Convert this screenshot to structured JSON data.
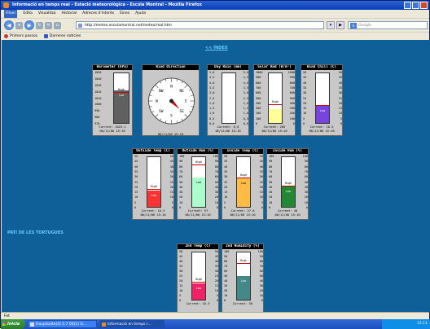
{
  "window": {
    "title": "Informació en temps real - Estació meteorològica - Escola Montral - Mozilla Firefox"
  },
  "menu": [
    "Fitxer",
    "Edita",
    "Visualitza",
    "Historial",
    "Adreces d'interès",
    "Eines",
    "Ajuda"
  ],
  "nav": {
    "url": "http://meteo.escolamontral.net/meteo/real.htm",
    "search_placeholder": "Google",
    "search_engine_icon": "G"
  },
  "bookmarks": [
    "Primers passos",
    "Darreres notícies"
  ],
  "page": {
    "index_link": "<< ÍNDEX",
    "side_link": "PATI DE LES TORTUGUES"
  },
  "compass": {
    "title": "Wind Direction",
    "direction_deg": 135,
    "date": "06/11/06 15:10",
    "points": [
      "N",
      "NE",
      "E",
      "SE",
      "S",
      "SW",
      "W",
      "NW"
    ]
  },
  "gauges": [
    {
      "title": "Barometer (hPa)",
      "ticks": [
        "1050",
        "1040",
        "1030",
        "1020",
        "1010",
        "1000",
        "990",
        "980",
        "970"
      ],
      "fill": 0.64,
      "high": 0.64,
      "low_label": "Low",
      "high_label": "High",
      "color": "#606060",
      "current": "Current: 1025.1",
      "date": "06/11/06 15:10"
    },
    {
      "title": "Day Rain (mm)",
      "ticks": [
        "5,0",
        "4,5",
        "4,0",
        "3,5",
        "3,0",
        "2,5",
        "2,0",
        "1,5",
        "1,0",
        "0,5",
        "0,0"
      ],
      "ticks2": [
        "5,0",
        "4,5",
        "4,0",
        "3,5",
        "3,0",
        "2,5",
        "2,0",
        "1,5",
        "1,0",
        "0,5",
        "0,0"
      ],
      "fill": 0,
      "high": null,
      "color": "#606060",
      "current": "Current: 0,0",
      "date": "06/11/06 15:10"
    },
    {
      "title": "Solar Rad (W/m²)",
      "ticks": [
        "1000",
        "900",
        "800",
        "700",
        "600",
        "500",
        "400",
        "300",
        "200",
        "100",
        "0"
      ],
      "ticks2": [
        "1000",
        "900",
        "800",
        "700",
        "600",
        "500",
        "400",
        "300",
        "200",
        "100",
        "0"
      ],
      "fill": 0.27,
      "high": 0.4,
      "low_label": "",
      "high_label": "High",
      "color": "#ffff99",
      "current": "Current: 285",
      "date": "06/11/06 15:10"
    },
    {
      "title": "Wind Chill (C)",
      "ticks": [
        "50",
        "45",
        "40",
        "35",
        "30",
        "25",
        "20",
        "15",
        "10",
        "5",
        "0"
      ],
      "ticks2": [
        "50",
        "45",
        "40",
        "35",
        "30",
        "25",
        "20",
        "15",
        "10",
        "5",
        "0"
      ],
      "fill": 0.33,
      "high": 0.38,
      "low_label": "Low",
      "high_label": "",
      "color": "#7744dd",
      "current": "Current: 16.5",
      "date": "06/11/06 15:10"
    },
    {
      "title": "Outside Temp (C)",
      "ticks": [
        "50",
        "45",
        "40",
        "35",
        "30",
        "25",
        "20",
        "15",
        "10",
        "5",
        "0"
      ],
      "ticks2": [
        "50",
        "45",
        "40",
        "35",
        "30",
        "25",
        "20",
        "15",
        "10",
        "5",
        "0"
      ],
      "fill": 0.32,
      "high": 0.38,
      "low_label": "Low",
      "high_label": "High",
      "color": "#ff3333",
      "current": "Current: 16.5",
      "date": "06/11/06 15:10"
    },
    {
      "title": "Outside Hum (%)",
      "ticks": [
        "100",
        "90",
        "80",
        "70",
        "60",
        "50",
        "40",
        "30",
        "20",
        "10",
        "0"
      ],
      "ticks2": [
        "100",
        "90",
        "80",
        "70",
        "60",
        "50",
        "40",
        "30",
        "20",
        "10",
        "0"
      ],
      "fill": 0.57,
      "high": 0.86,
      "low_label": "Low",
      "high_label": "High",
      "color": "#aaffcc",
      "current": "Current: 57",
      "date": "06/11/06 15:10"
    },
    {
      "title": "Inside Temp (C)",
      "ticks": [
        "50",
        "45",
        "40",
        "35",
        "30",
        "25",
        "20",
        "15",
        "10",
        "5",
        "0"
      ],
      "ticks2": [
        "50",
        "45",
        "40",
        "35",
        "30",
        "25",
        "20",
        "15",
        "10",
        "5",
        "0"
      ],
      "fill": 0.55,
      "high": 0.6,
      "low_label": "Low",
      "high_label": "High",
      "color": "#ffbb44",
      "current": "Current: 27.6",
      "date": "06/11/06 15:10"
    },
    {
      "title": "Inside Hum (%)",
      "ticks": [
        "100",
        "90",
        "80",
        "70",
        "60",
        "50",
        "40",
        "30",
        "20",
        "10",
        "0"
      ],
      "ticks2": [
        "100",
        "90",
        "80",
        "70",
        "60",
        "50",
        "40",
        "30",
        "20",
        "10",
        "0"
      ],
      "fill": 0.4,
      "high": 0.45,
      "low_label": "Low",
      "high_label": "High",
      "color": "#228833",
      "current": "Current: 40",
      "date": "06/11/06 15:10"
    },
    {
      "title": "2nd Temp (C)",
      "ticks": [
        "50",
        "45",
        "40",
        "35",
        "30",
        "25",
        "20",
        "15",
        "10",
        "5",
        "0"
      ],
      "ticks2": [
        "50",
        "45",
        "40",
        "35",
        "30",
        "25",
        "20",
        "15",
        "10",
        "5",
        "0"
      ],
      "fill": 0.33,
      "high": 0.4,
      "low_label": "Low",
      "high_label": "High",
      "color": "#ee2266",
      "current": "Current: 16.3",
      "date": ""
    },
    {
      "title": "2nd Humidity (%)",
      "ticks": [
        "100",
        "90",
        "80",
        "70",
        "60",
        "50",
        "40",
        "30",
        "20",
        "10",
        "0"
      ],
      "ticks2": [
        "100",
        "90",
        "80",
        "70",
        "60",
        "50",
        "40",
        "30",
        "20",
        "10",
        "0"
      ],
      "fill": 0.48,
      "high": 0.79,
      "low_label": "Low",
      "high_label": "High",
      "color": "#448888",
      "current": "Current: 56",
      "date": ""
    }
  ],
  "status": "Fet",
  "taskbar": {
    "start": "Inicia",
    "tasks": [
      "Hauptseite(d) 5.7 06(1) G...",
      "Informació en temps r..."
    ],
    "clock": "15:11"
  }
}
